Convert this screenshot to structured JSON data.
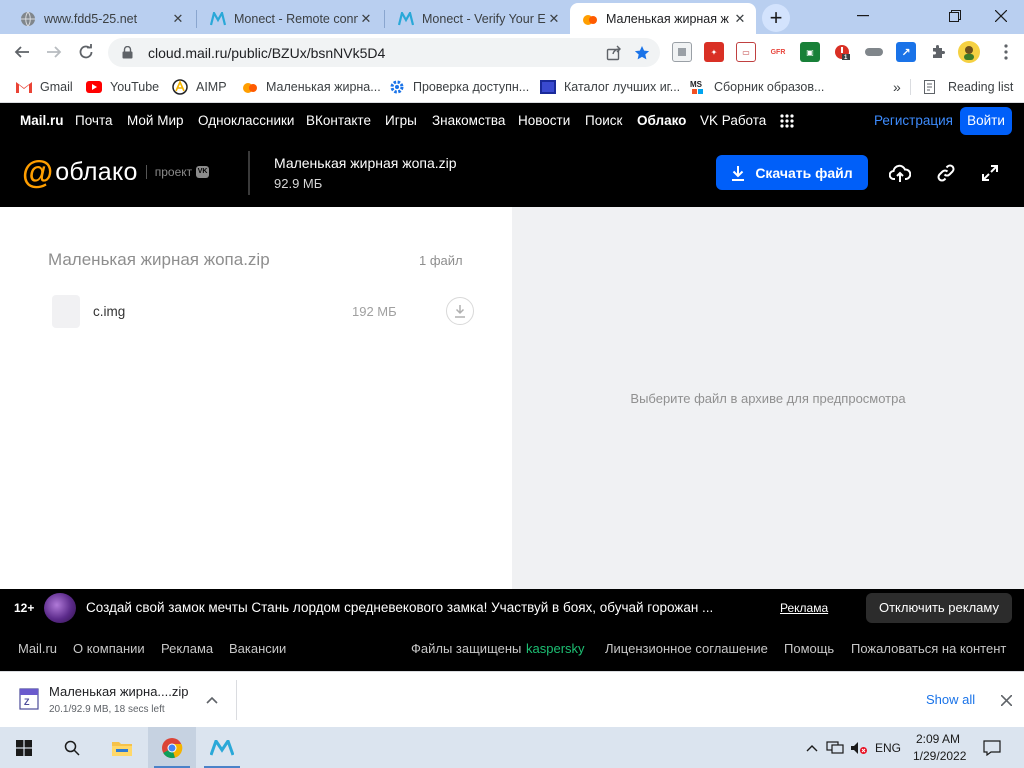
{
  "browser": {
    "tabs": [
      {
        "title": "www.fdd5-25.net",
        "icon": "globe-icon"
      },
      {
        "title": "Monect - Remote conn",
        "icon": "monect-icon"
      },
      {
        "title": "Monect - Verify Your E",
        "icon": "monect-icon"
      },
      {
        "title": "Маленькая жирная ж",
        "icon": "mail-cloud-icon"
      }
    ],
    "url": "cloud.mail.ru/public/BZUx/bsnNVk5D4",
    "bookmarks": [
      {
        "label": "Gmail",
        "icon": "gmail-icon"
      },
      {
        "label": "YouTube",
        "icon": "youtube-icon"
      },
      {
        "label": "AIMP",
        "icon": "aimp-icon"
      },
      {
        "label": "Маленькая жирна...",
        "icon": "mail-cloud-icon"
      },
      {
        "label": "Проверка доступн...",
        "icon": "gear-icon"
      },
      {
        "label": "Каталог лучших иг...",
        "icon": "catalog-icon"
      },
      {
        "label": "Сборник образов...",
        "icon": "ms-icon"
      }
    ],
    "bookmarks_more": "»",
    "reading_list": "Reading list"
  },
  "mailnav": {
    "items": [
      "Mail.ru",
      "Почта",
      "Мой Мир",
      "Одноклассники",
      "ВКонтакте",
      "Игры",
      "Знакомства",
      "Новости",
      "Поиск",
      "Облако",
      "VK Работа"
    ],
    "register": "Регистрация",
    "login": "Войти"
  },
  "cloud": {
    "logo_at": "@",
    "logo_word": "облако",
    "logo_project": "проект",
    "logo_vk": "VK",
    "file_name": "Маленькая жирная жопа.zip",
    "file_size": "92.9 МБ",
    "download_button": "Скачать файл"
  },
  "archive": {
    "name": "Маленькая жирная жопа.zip",
    "count": "1 файл",
    "files": [
      {
        "name": "c.img",
        "size": "192 МБ"
      }
    ],
    "preview_hint": "Выберите файл в архиве для предпросмотра"
  },
  "ad": {
    "age": "12+",
    "text": "Создай свой замок мечты Стань лордом средневекового замка! Участвуй в боях, обучай горожан ...",
    "link": "Реклама",
    "disable": "Отключить рекламу"
  },
  "footer": {
    "left": [
      "Mail.ru",
      "О компании",
      "Реклама",
      "Вакансии"
    ],
    "protected": "Файлы защищены",
    "kaspersky": "kaspersky",
    "right": [
      "Лицензионное соглашение",
      "Помощь",
      "Пожаловаться на контент"
    ]
  },
  "download": {
    "name": "Маленькая жирна....zip",
    "status": "20.1/92.9 MB, 18 secs left",
    "show_all": "Show all"
  },
  "taskbar": {
    "lang": "ENG",
    "time": "2:09 AM",
    "date": "1/29/2022"
  },
  "colors": {
    "accent_blue": "#005ff9",
    "logo_orange": "#ff9e00",
    "kaspersky_green": "#1dbf73"
  }
}
